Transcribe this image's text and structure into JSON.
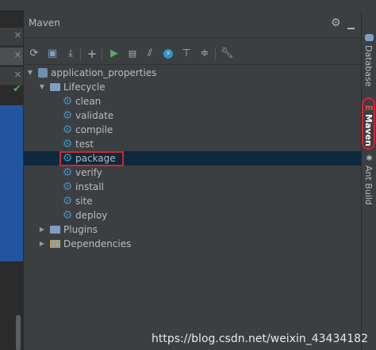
{
  "panel": {
    "title": "Maven"
  },
  "toolbar": {
    "buttons": [
      {
        "name": "refresh-icon"
      },
      {
        "name": "generate-sources-icon"
      },
      {
        "name": "download-sources-icon"
      },
      {
        "name": "add-icon"
      },
      {
        "name": "run-icon"
      },
      {
        "name": "run-config-icon"
      },
      {
        "name": "skip-tests-icon"
      },
      {
        "name": "offline-mode-icon"
      },
      {
        "name": "show-dependencies-icon"
      },
      {
        "name": "collapse-all-icon"
      },
      {
        "name": "settings-wrench-icon"
      }
    ]
  },
  "tree": {
    "project": "application_properties",
    "lifecycle": "Lifecycle",
    "goals": [
      "clean",
      "validate",
      "compile",
      "test",
      "package",
      "verify",
      "install",
      "site",
      "deploy"
    ],
    "selected_goal": "package",
    "plugins": "Plugins",
    "dependencies": "Dependencies"
  },
  "right_strip": {
    "database": "Database",
    "maven": "Maven",
    "ant": "Ant Build"
  },
  "watermark": "https://blog.csdn.net/weixin_43434182",
  "colors": {
    "background": "#3c3f41",
    "selection": "#0d293e",
    "gear": "#3592c4",
    "annotation": "#d6242c"
  }
}
